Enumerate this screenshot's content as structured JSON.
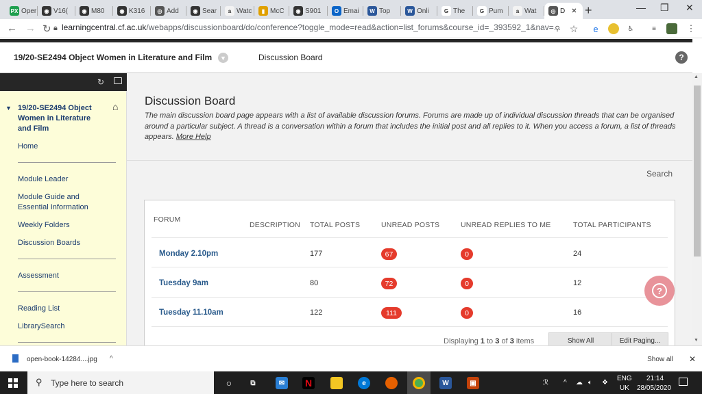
{
  "browser": {
    "tabs": [
      {
        "label": "Oper",
        "icon": "PX",
        "color": "#1e9f4e"
      },
      {
        "label": "V16(",
        "icon": "◉",
        "color": "#333333"
      },
      {
        "label": "M80",
        "icon": "◉",
        "color": "#333333"
      },
      {
        "label": "K316",
        "icon": "◉",
        "color": "#333333"
      },
      {
        "label": "Add",
        "icon": "◎",
        "color": "#555555"
      },
      {
        "label": "Sear",
        "icon": "◉",
        "color": "#333333"
      },
      {
        "label": "Watc",
        "icon": "a",
        "color": "#f3f3f3"
      },
      {
        "label": "McC",
        "icon": "▮",
        "color": "#e0a000"
      },
      {
        "label": "S901",
        "icon": "◉",
        "color": "#333333"
      },
      {
        "label": "Emai",
        "icon": "O",
        "color": "#0a64c8"
      },
      {
        "label": "Top",
        "icon": "W",
        "color": "#2b579a"
      },
      {
        "label": "Onli",
        "icon": "W",
        "color": "#2b579a"
      },
      {
        "label": "The",
        "icon": "G",
        "color": "#ffffff"
      },
      {
        "label": "Pum",
        "icon": "G",
        "color": "#ffffff"
      },
      {
        "label": "Wat",
        "icon": "a",
        "color": "#f3f3f3"
      },
      {
        "label": "D",
        "icon": "◎",
        "color": "#555555"
      }
    ],
    "url_host": "learningcentral.cf.ac.uk",
    "url_path": "/webapps/discussionboard/do/conference?toggle_mode=read&action=list_forums&course_id=_393592_1&nav=..."
  },
  "header": {
    "course_title": "19/20-SE2494 Object Women in Literature and Film",
    "breadcrumb": "Discussion Board",
    "help": "?"
  },
  "sidebar": {
    "course_title": "19/20-SE2494 Object Women in Literature and Film",
    "items": [
      {
        "label": "Home"
      },
      {
        "label": "Module Leader"
      },
      {
        "label": "Module Guide and Essential Information"
      },
      {
        "label": "Weekly Folders"
      },
      {
        "label": "Discussion Boards"
      },
      {
        "label": "Assessment"
      },
      {
        "label": "Reading List"
      },
      {
        "label": "LibrarySearch"
      }
    ]
  },
  "main": {
    "title": "Discussion Board",
    "description": "The main discussion board page appears with a list of available discussion forums. Forums are made up of individual discussion threads that can be organised around a particular subject. A thread is a conversation within a forum that includes the initial post and all replies to it. When you access a forum, a list of threads appears.",
    "more_help": "More Help",
    "search": "Search",
    "columns": [
      "FORUM",
      "DESCRIPTION",
      "TOTAL POSTS",
      "UNREAD POSTS",
      "UNREAD REPLIES TO ME",
      "TOTAL PARTICIPANTS"
    ],
    "forums": [
      {
        "name": "Monday 2.10pm",
        "total_posts": "177",
        "unread_posts": "67",
        "unread_replies": "0",
        "participants": "24"
      },
      {
        "name": "Tuesday 9am",
        "total_posts": "80",
        "unread_posts": "72",
        "unread_replies": "0",
        "participants": "12"
      },
      {
        "name": "Tuesday 11.10am",
        "total_posts": "122",
        "unread_posts": "111",
        "unread_replies": "0",
        "participants": "16"
      }
    ],
    "pager": {
      "prefix": "Displaying",
      "from": "1",
      "to_word": "to",
      "to": "3",
      "of_word": "of",
      "total": "3",
      "suffix": "items"
    },
    "show_all": "Show All",
    "edit_paging": "Edit Paging..."
  },
  "downloads": {
    "file": "open-book-14284....jpg",
    "show_all": "Show all"
  },
  "taskbar": {
    "search_placeholder": "Type here to search",
    "lang": "ENG",
    "region": "UK",
    "time": "21:14",
    "date": "28/05/2020"
  }
}
